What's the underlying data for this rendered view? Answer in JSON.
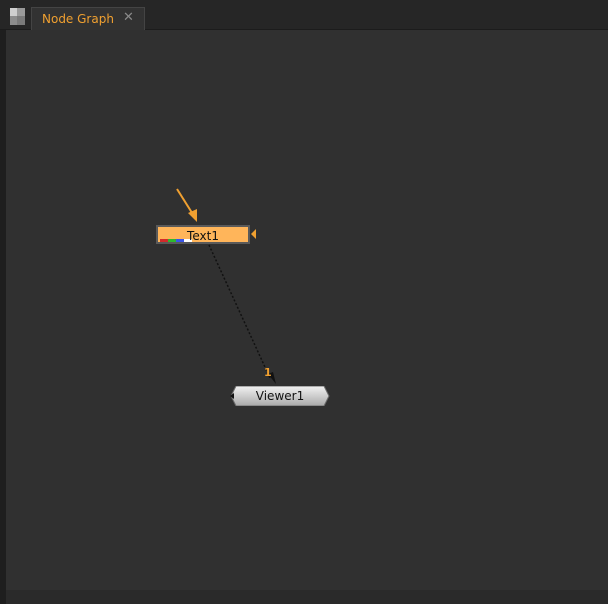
{
  "tabs": [
    {
      "label": "Node Graph",
      "close_glyph": "✕",
      "active": true
    }
  ],
  "nodes": {
    "text": {
      "label": "Text1",
      "color": "#ffb55a",
      "channels": [
        "#d22b2b",
        "#2fb82f",
        "#3a55e8",
        "#ffffff"
      ]
    },
    "viewer": {
      "label": "Viewer1"
    }
  },
  "connection": {
    "input_number": "1"
  },
  "colors": {
    "accent": "#f0a030",
    "background": "#303030"
  },
  "icons": {
    "panel_menu": "panel-menu-icon",
    "pointer": "orange-arrow-icon"
  }
}
